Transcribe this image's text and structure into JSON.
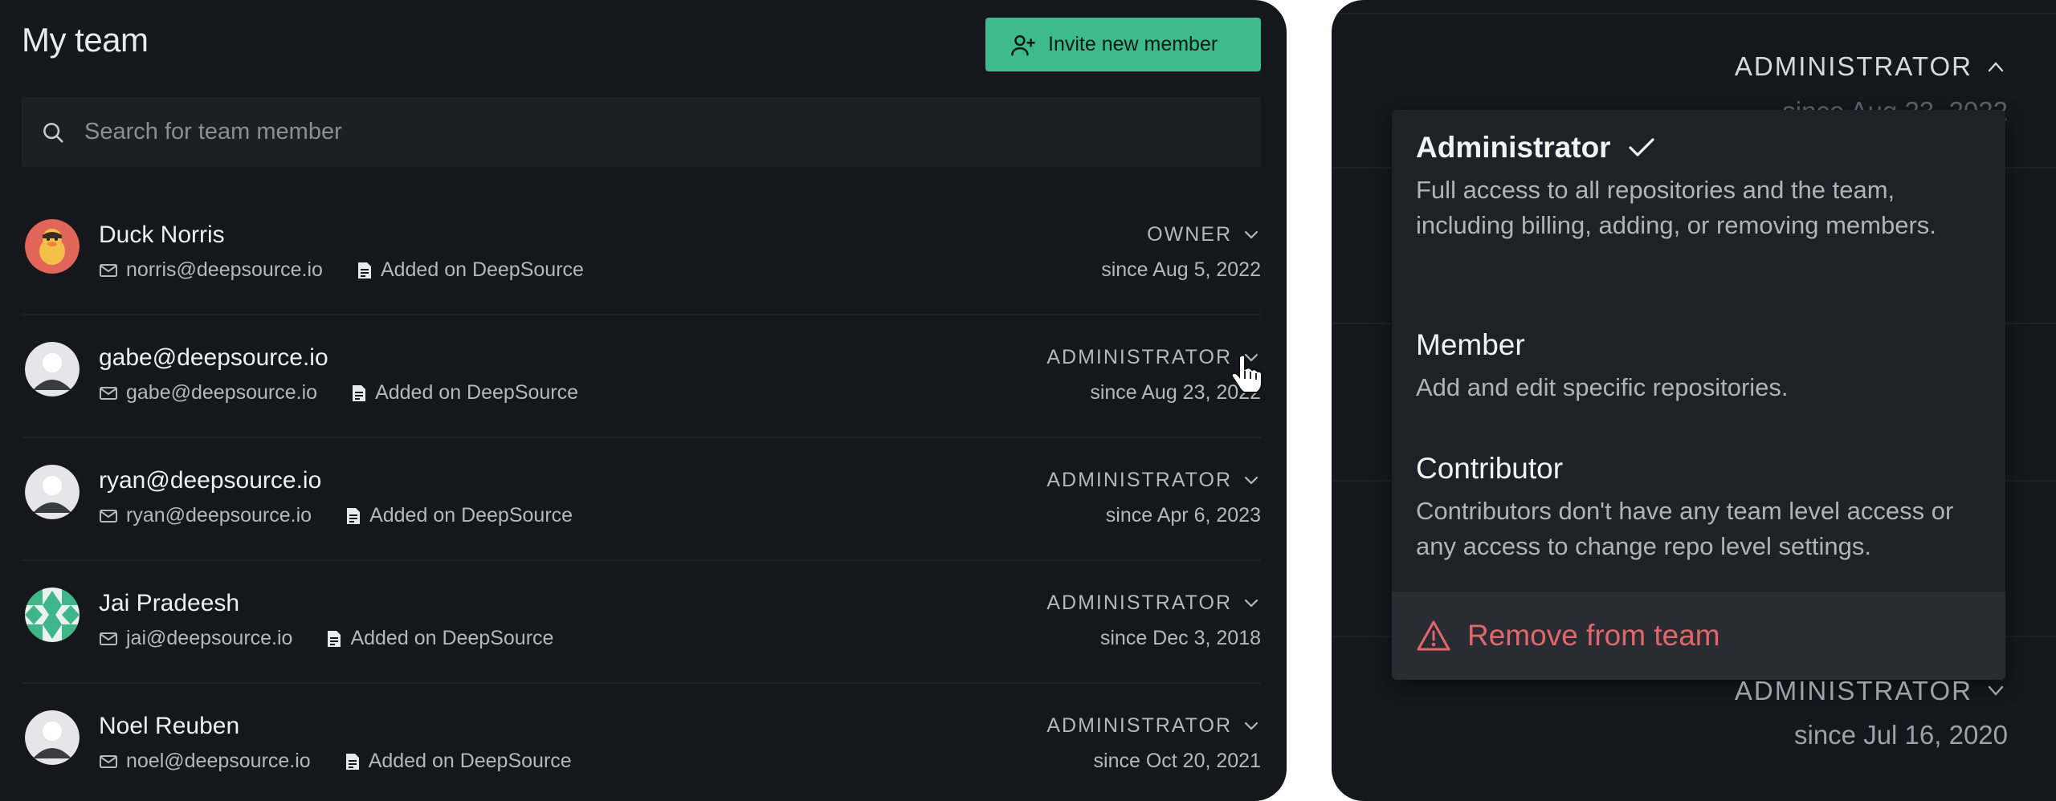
{
  "header": {
    "title": "My team",
    "invite_label": "Invite new member"
  },
  "search": {
    "placeholder": "Search for team member"
  },
  "members": [
    {
      "name": "Duck Norris",
      "email": "norris@deepsource.io",
      "source": "Added on DeepSource",
      "role": "OWNER",
      "since": "since Aug 5, 2022",
      "avatar": "duck-avatar"
    },
    {
      "name": "gabe@deepsource.io",
      "email": "gabe@deepsource.io",
      "source": "Added on DeepSource",
      "role": "ADMINISTRATOR",
      "since": "since Aug 23, 2022",
      "avatar": "default-avatar"
    },
    {
      "name": "ryan@deepsource.io",
      "email": "ryan@deepsource.io",
      "source": "Added on DeepSource",
      "role": "ADMINISTRATOR",
      "since": "since Apr 6, 2023",
      "avatar": "default-avatar"
    },
    {
      "name": "Jai Pradeesh",
      "email": "jai@deepsource.io",
      "source": "Added on DeepSource",
      "role": "ADMINISTRATOR",
      "since": "since Dec 3, 2018",
      "avatar": "pattern-avatar"
    },
    {
      "name": "Noel Reuben",
      "email": "noel@deepsource.io",
      "source": "Added on DeepSource",
      "role": "ADMINISTRATOR",
      "since": "since Oct 20, 2021",
      "avatar": "default-avatar"
    }
  ],
  "zoom_panel": {
    "top_role": "ADMINISTRATOR",
    "top_since_partial": "since Aug 23, 2022",
    "bottom_role": "ADMINISTRATOR",
    "bottom_since": "since Jul 16, 2020",
    "dropdown": {
      "options": [
        {
          "title": "Administrator",
          "desc": "Full access to all repositories and the team, including billing, adding, or removing members.",
          "selected": true
        },
        {
          "title": "Member",
          "desc": "Add and edit specific repositories.",
          "selected": false
        },
        {
          "title": "Contributor",
          "desc": "Contributors don't have any team level access or any access to change repo level settings.",
          "selected": false
        }
      ],
      "remove_label": "Remove from team"
    }
  },
  "colors": {
    "background": "#16171c",
    "accent": "#3dbb8c",
    "danger": "#e2676a"
  }
}
